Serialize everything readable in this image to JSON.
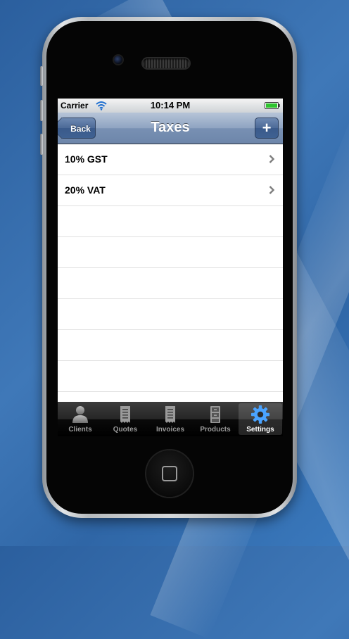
{
  "status_bar": {
    "carrier": "Carrier",
    "time": "10:14 PM"
  },
  "nav_bar": {
    "back_label": "Back",
    "title": "Taxes",
    "add_label": "+"
  },
  "taxes": [
    {
      "label": "10% GST"
    },
    {
      "label": "20% VAT"
    }
  ],
  "tab_bar": {
    "tabs": [
      {
        "label": "Clients",
        "icon": "person-icon"
      },
      {
        "label": "Quotes",
        "icon": "receipt-icon"
      },
      {
        "label": "Invoices",
        "icon": "receipt-icon"
      },
      {
        "label": "Products",
        "icon": "cabinet-icon"
      },
      {
        "label": "Settings",
        "icon": "gear-icon",
        "selected": true
      }
    ]
  },
  "colors": {
    "nav_bar": "#7890b3",
    "selected_tab_icon": "#4aa3ff"
  }
}
